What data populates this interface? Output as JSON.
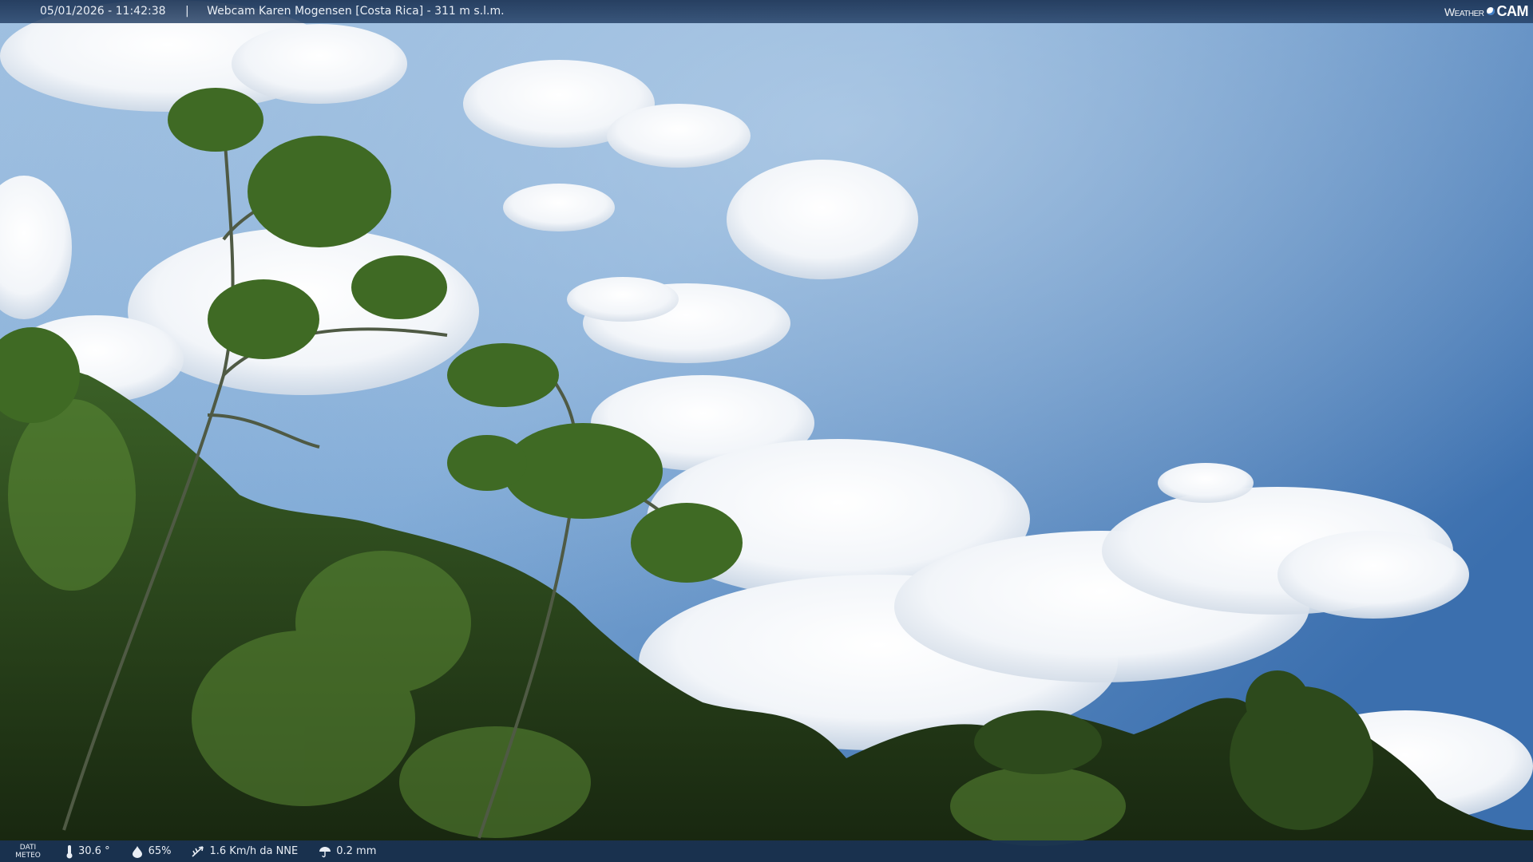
{
  "header": {
    "datetime": "05/01/2026 - 11:42:38",
    "separator": "|",
    "location": "Webcam Karen Mogensen [Costa Rica] - 311 m s.l.m."
  },
  "logo": {
    "word1": "Weather",
    "word2": "CAM"
  },
  "footer": {
    "dati_line1": "DATI",
    "dati_line2": "METEO",
    "temperature": "30.6 °",
    "humidity": "65%",
    "wind": "1.6 Km/h da NNE",
    "rain": "0.2 mm"
  },
  "icons": [
    "thermometer-icon",
    "humidity-drop-icon",
    "wind-icon",
    "rain-icon"
  ],
  "colors": {
    "sky_top": "#8fb6dc",
    "sky_right": "#3c70b0",
    "bar": "#1c3456",
    "foliage": "#2e4a1e"
  }
}
